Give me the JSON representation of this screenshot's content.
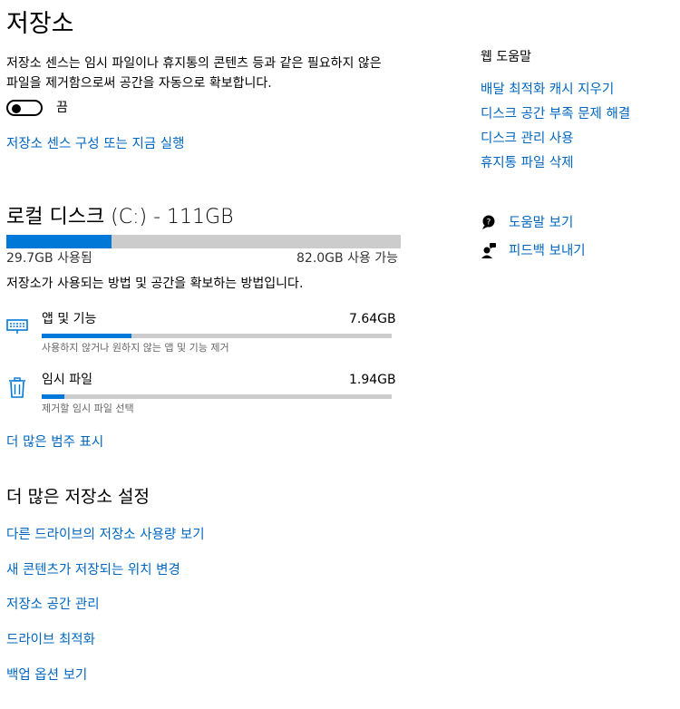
{
  "page_title": "저장소",
  "storage_sense": {
    "description": "저장소 센스는 임시 파일이나 휴지통의 콘텐츠 등과 같은 필요하지 않은 파일을 제거함으로써 공간을 자동으로 확보합니다.",
    "toggle_state": "끔",
    "configure_link": "저장소 센스 구성 또는 지금 실행"
  },
  "disk": {
    "title": "로컬 디스크 (C:) - 111GB",
    "used_label": "29.7GB 사용됨",
    "free_label": "82.0GB 사용 가능",
    "used_fraction": 0.267,
    "summary": "저장소가 사용되는 방법 및 공간을 확보하는 방법입니다."
  },
  "categories": [
    {
      "name": "앱 및 기능",
      "size": "7.64GB",
      "hint": "사용하지 않거나 원하지 않는 앱 및 기능 제거",
      "fraction": 0.257,
      "icon": "keyboard-icon"
    },
    {
      "name": "임시 파일",
      "size": "1.94GB",
      "hint": "제거할 임시 파일 선택",
      "fraction": 0.065,
      "icon": "trash-icon"
    }
  ],
  "show_more_link": "더 많은 범주 표시",
  "more_settings": {
    "title": "더 많은 저장소 설정",
    "links": [
      "다른 드라이브의 저장소 사용량 보기",
      "새 콘텐츠가 저장되는 위치 변경",
      "저장소 공간 관리",
      "드라이브 최적화",
      "백업 옵션 보기"
    ]
  },
  "help": {
    "title": "웹 도움말",
    "links": [
      "배달 최적화 캐시 지우기",
      "디스크 공간 부족 문제 해결",
      "디스크 관리 사용",
      "휴지통 파일 삭제"
    ],
    "get_help": "도움말 보기",
    "feedback": "피드백 보내기"
  },
  "colors": {
    "accent": "#0078d7",
    "link": "#0067c0",
    "track": "#cccccc"
  }
}
